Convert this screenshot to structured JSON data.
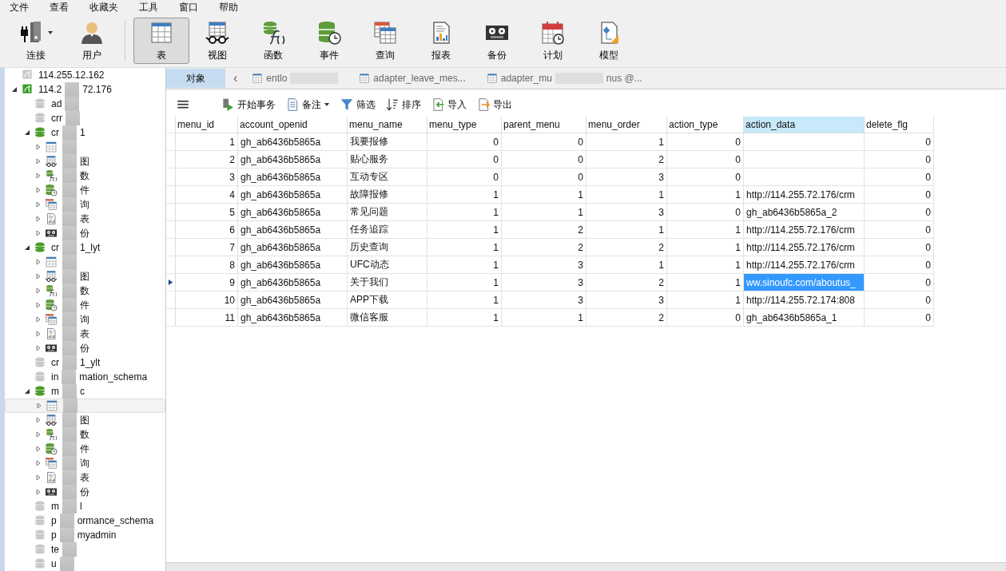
{
  "menu_bar": [
    "文件",
    "查看",
    "收藏夹",
    "工具",
    "窗口",
    "帮助"
  ],
  "toolbar": {
    "groups": [
      [
        {
          "kind": "connection",
          "label": "连接",
          "dropdown": true,
          "selected": false
        },
        {
          "kind": "user",
          "label": "用户",
          "dropdown": false,
          "selected": false
        }
      ],
      [
        {
          "kind": "table",
          "label": "表",
          "dropdown": false,
          "selected": true
        },
        {
          "kind": "view",
          "label": "视图",
          "dropdown": false,
          "selected": false
        },
        {
          "kind": "function",
          "label": "函数",
          "dropdown": false,
          "selected": false
        },
        {
          "kind": "event",
          "label": "事件",
          "dropdown": false,
          "selected": false
        },
        {
          "kind": "query",
          "label": "查询",
          "dropdown": false,
          "selected": false
        },
        {
          "kind": "report",
          "label": "报表",
          "dropdown": false,
          "selected": false
        },
        {
          "kind": "backup",
          "label": "备份",
          "dropdown": false,
          "selected": false
        },
        {
          "kind": "schedule",
          "label": "计划",
          "dropdown": false,
          "selected": false
        },
        {
          "kind": "model",
          "label": "模型",
          "dropdown": false,
          "selected": false
        }
      ]
    ]
  },
  "sidebar": {
    "tree": [
      {
        "kind": "server",
        "connected": false,
        "expanded": false,
        "label_before": "114.255.12.162",
        "redacted": false
      },
      {
        "kind": "server",
        "connected": true,
        "expanded": true,
        "label_before": "114.2",
        "label_after": "72.176",
        "redacted": true,
        "children": [
          {
            "kind": "database",
            "open": false,
            "expanded": false,
            "label_before": "ad",
            "redacted": true
          },
          {
            "kind": "database",
            "open": false,
            "expanded": false,
            "label_before": "crr",
            "redacted": true
          },
          {
            "kind": "database",
            "open": true,
            "expanded": true,
            "label_before": "cr",
            "label_after": "1",
            "redacted": true,
            "children": [
              {
                "kind": "table",
                "redacted": true,
                "selected": false
              },
              {
                "kind": "view",
                "label_after": "图",
                "redacted": true,
                "selected": false
              },
              {
                "kind": "function",
                "label_after": "数",
                "redacted": true,
                "selected": false
              },
              {
                "kind": "event",
                "label_after": "件",
                "redacted": true,
                "selected": false
              },
              {
                "kind": "query",
                "label_after": "询",
                "redacted": true,
                "selected": false
              },
              {
                "kind": "report",
                "label_after": "表",
                "redacted": true,
                "selected": false
              },
              {
                "kind": "backup",
                "label_after": "份",
                "redacted": true,
                "selected": false
              }
            ]
          },
          {
            "kind": "database",
            "open": true,
            "expanded": true,
            "label_before": "cr",
            "label_after": "1_lyt",
            "redacted": true,
            "children": [
              {
                "kind": "table",
                "redacted": true,
                "selected": false
              },
              {
                "kind": "view",
                "label_after": "图",
                "redacted": true,
                "selected": false
              },
              {
                "kind": "function",
                "label_after": "数",
                "redacted": true,
                "selected": false
              },
              {
                "kind": "event",
                "label_after": "件",
                "redacted": true,
                "selected": false
              },
              {
                "kind": "query",
                "label_after": "询",
                "redacted": true,
                "selected": false
              },
              {
                "kind": "report",
                "label_after": "表",
                "redacted": true,
                "selected": false
              },
              {
                "kind": "backup",
                "label_after": "份",
                "redacted": true,
                "selected": false
              }
            ]
          },
          {
            "kind": "database",
            "open": false,
            "expanded": false,
            "label_before": "cr",
            "label_after": "1_ylt",
            "redacted": true
          },
          {
            "kind": "database",
            "open": false,
            "expanded": false,
            "label_before": "in",
            "label_after": "mation_schema",
            "redacted": true
          },
          {
            "kind": "database",
            "open": true,
            "expanded": true,
            "label_before": "m",
            "label_after": "c",
            "redacted": true,
            "children": [
              {
                "kind": "table",
                "redacted": true,
                "selected": true
              },
              {
                "kind": "view",
                "label_after": "图",
                "redacted": true,
                "selected": false
              },
              {
                "kind": "function",
                "label_after": "数",
                "redacted": true,
                "selected": false
              },
              {
                "kind": "event",
                "label_after": "件",
                "redacted": true,
                "selected": false
              },
              {
                "kind": "query",
                "label_after": "询",
                "redacted": true,
                "selected": false
              },
              {
                "kind": "report",
                "label_after": "表",
                "redacted": true,
                "selected": false
              },
              {
                "kind": "backup",
                "label_after": "份",
                "redacted": true,
                "selected": false
              }
            ]
          },
          {
            "kind": "database",
            "open": false,
            "expanded": false,
            "label_before": "m",
            "label_after": "l",
            "redacted": true
          },
          {
            "kind": "database",
            "open": false,
            "expanded": false,
            "label_before": "p",
            "label_after": "ormance_schema",
            "redacted": true
          },
          {
            "kind": "database",
            "open": false,
            "expanded": false,
            "label_before": "p",
            "label_after": "myadmin",
            "redacted": true
          },
          {
            "kind": "database",
            "open": false,
            "expanded": false,
            "label_before": "te",
            "redacted": true
          },
          {
            "kind": "database",
            "open": false,
            "expanded": false,
            "label_before": "u",
            "redacted": true
          }
        ]
      }
    ]
  },
  "tab_bar": {
    "scroll_left": "‹",
    "tabs": [
      {
        "kind": "object",
        "label_before": "对象",
        "redacted": false,
        "selected": true
      },
      {
        "kind": "table",
        "label_before": "entlo",
        "redacted": true,
        "selected": false
      },
      {
        "kind": "table",
        "label_before": "adapter_leave_mes...",
        "redacted": false,
        "selected": false
      },
      {
        "kind": "table",
        "label_before": "adapter_mu",
        "label_after": "nus @...",
        "redacted": true,
        "selected": false
      }
    ]
  },
  "grid_toolbar": [
    {
      "kind": "menu"
    },
    {
      "kind": "transaction",
      "label": "开始事务",
      "dropdown": false
    },
    {
      "kind": "note",
      "label": "备注",
      "dropdown": true
    },
    {
      "kind": "filter",
      "label": "筛选",
      "dropdown": false
    },
    {
      "kind": "sort",
      "label": "排序",
      "dropdown": false
    },
    {
      "kind": "import",
      "label": "导入",
      "dropdown": false
    },
    {
      "kind": "export",
      "label": "导出",
      "dropdown": false
    }
  ],
  "table": {
    "columns": [
      {
        "name": "menu_id",
        "focused": false
      },
      {
        "name": "account_openid",
        "focused": false
      },
      {
        "name": "menu_name",
        "focused": false
      },
      {
        "name": "menu_type",
        "focused": false
      },
      {
        "name": "parent_menu",
        "focused": false
      },
      {
        "name": "menu_order",
        "focused": false
      },
      {
        "name": "action_type",
        "focused": false
      },
      {
        "name": "action_data",
        "focused": true
      },
      {
        "name": "delete_flg",
        "focused": false
      }
    ],
    "rows": [
      {
        "selected": false,
        "cells": [
          "1",
          "gh_ab6436b5865a",
          "我要报修",
          "0",
          "0",
          "1",
          "0",
          null,
          "0"
        ]
      },
      {
        "selected": false,
        "cells": [
          "2",
          "gh_ab6436b5865a",
          "贴心服务",
          "0",
          "0",
          "2",
          "0",
          null,
          "0"
        ]
      },
      {
        "selected": false,
        "cells": [
          "3",
          "gh_ab6436b5865a",
          "互动专区",
          "0",
          "0",
          "3",
          "0",
          null,
          "0"
        ]
      },
      {
        "selected": false,
        "cells": [
          "4",
          "gh_ab6436b5865a",
          "故障报修",
          "1",
          "1",
          "1",
          "1",
          "http://114.255.72.176/crm",
          "0"
        ]
      },
      {
        "selected": false,
        "cells": [
          "5",
          "gh_ab6436b5865a",
          "常见问题",
          "1",
          "1",
          "3",
          "0",
          "gh_ab6436b5865a_2",
          "0"
        ]
      },
      {
        "selected": false,
        "cells": [
          "6",
          "gh_ab6436b5865a",
          "任务追踪",
          "1",
          "2",
          "1",
          "1",
          "http://114.255.72.176/crm",
          "0"
        ]
      },
      {
        "selected": false,
        "cells": [
          "7",
          "gh_ab6436b5865a",
          "历史查询",
          "1",
          "2",
          "2",
          "1",
          "http://114.255.72.176/crm",
          "0"
        ]
      },
      {
        "selected": false,
        "cells": [
          "8",
          "gh_ab6436b5865a",
          "UFC动态",
          "1",
          "3",
          "1",
          "1",
          "http://114.255.72.176/crm",
          "0"
        ]
      },
      {
        "selected": true,
        "cells": [
          "9",
          "gh_ab6436b5865a",
          "关于我们",
          "1",
          "3",
          "2",
          "1",
          "ww.sinoufc.com/aboutus_",
          "0"
        ]
      },
      {
        "selected": false,
        "cells": [
          "10",
          "gh_ab6436b5865a",
          "APP下载",
          "1",
          "3",
          "3",
          "1",
          "http://114.255.72.174:808",
          "0"
        ]
      },
      {
        "selected": false,
        "cells": [
          "11",
          "gh_ab6436b5865a",
          "微信客服",
          "1",
          "1",
          "2",
          "0",
          "gh_ab6436b5865a_1",
          "0"
        ]
      }
    ]
  }
}
